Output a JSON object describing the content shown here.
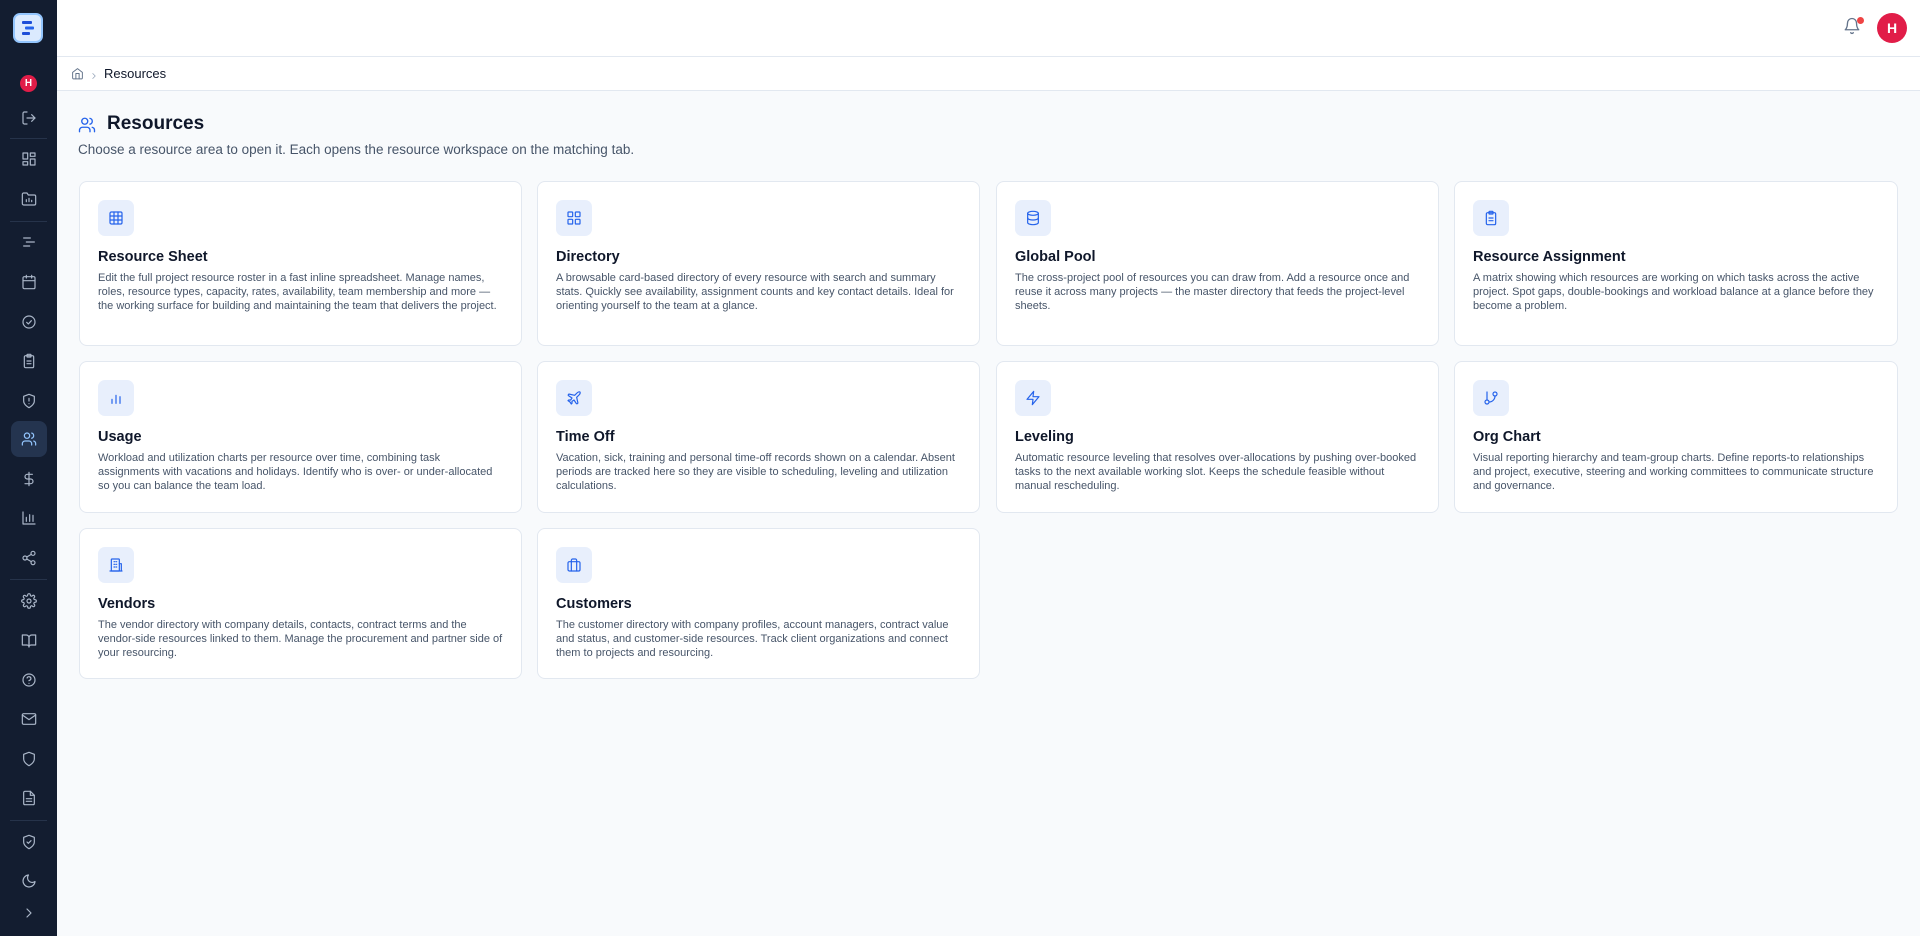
{
  "user": {
    "initial": "H"
  },
  "breadcrumb": {
    "current": "Resources"
  },
  "page": {
    "title": "Resources",
    "subtitle": "Choose a resource area to open it. Each opens the resource workspace on the matching tab."
  },
  "cards": [
    {
      "title": "Resource Sheet",
      "icon": "table-icon",
      "description": "Edit the full project resource roster in a fast inline spreadsheet. Manage names, roles, resource types, capacity, rates, availability, team membership and more — the working surface for building and maintaining the team that delivers the project."
    },
    {
      "title": "Directory",
      "icon": "grid-icon",
      "description": "A browsable card-based directory of every resource with search and summary stats. Quickly see availability, assignment counts and key contact details. Ideal for orienting yourself to the team at a glance."
    },
    {
      "title": "Global Pool",
      "icon": "database-icon",
      "description": "The cross-project pool of resources you can draw from. Add a resource once and reuse it across many projects — the master directory that feeds the project-level sheets."
    },
    {
      "title": "Resource Assignment",
      "icon": "clipboard-icon",
      "description": "A matrix showing which resources are working on which tasks across the active project. Spot gaps, double-bookings and workload balance at a glance before they become a problem."
    },
    {
      "title": "Usage",
      "icon": "bar-chart-icon",
      "description": "Workload and utilization charts per resource over time, combining task assignments with vacations and holidays. Identify who is over- or under-allocated so you can balance the team load."
    },
    {
      "title": "Time Off",
      "icon": "plane-icon",
      "description": "Vacation, sick, training and personal time-off records shown on a calendar. Absent periods are tracked here so they are visible to scheduling, leveling and utilization calculations."
    },
    {
      "title": "Leveling",
      "icon": "lightning-icon",
      "description": "Automatic resource leveling that resolves over-allocations by pushing over-booked tasks to the next available working slot. Keeps the schedule feasible without manual rescheduling."
    },
    {
      "title": "Org Chart",
      "icon": "git-branch-icon",
      "description": "Visual reporting hierarchy and team-group charts. Define reports-to relationships and project, executive, steering and working committees to communicate structure and governance."
    },
    {
      "title": "Vendors",
      "icon": "building-icon",
      "description": "The vendor directory with company details, contacts, contract terms and the vendor-side resources linked to them. Manage the procurement and partner side of your resourcing."
    },
    {
      "title": "Customers",
      "icon": "briefcase-icon",
      "description": "The customer directory with company profiles, account managers, contract value and status, and customer-side resources. Track client organizations and connect them to projects and resourcing."
    }
  ]
}
